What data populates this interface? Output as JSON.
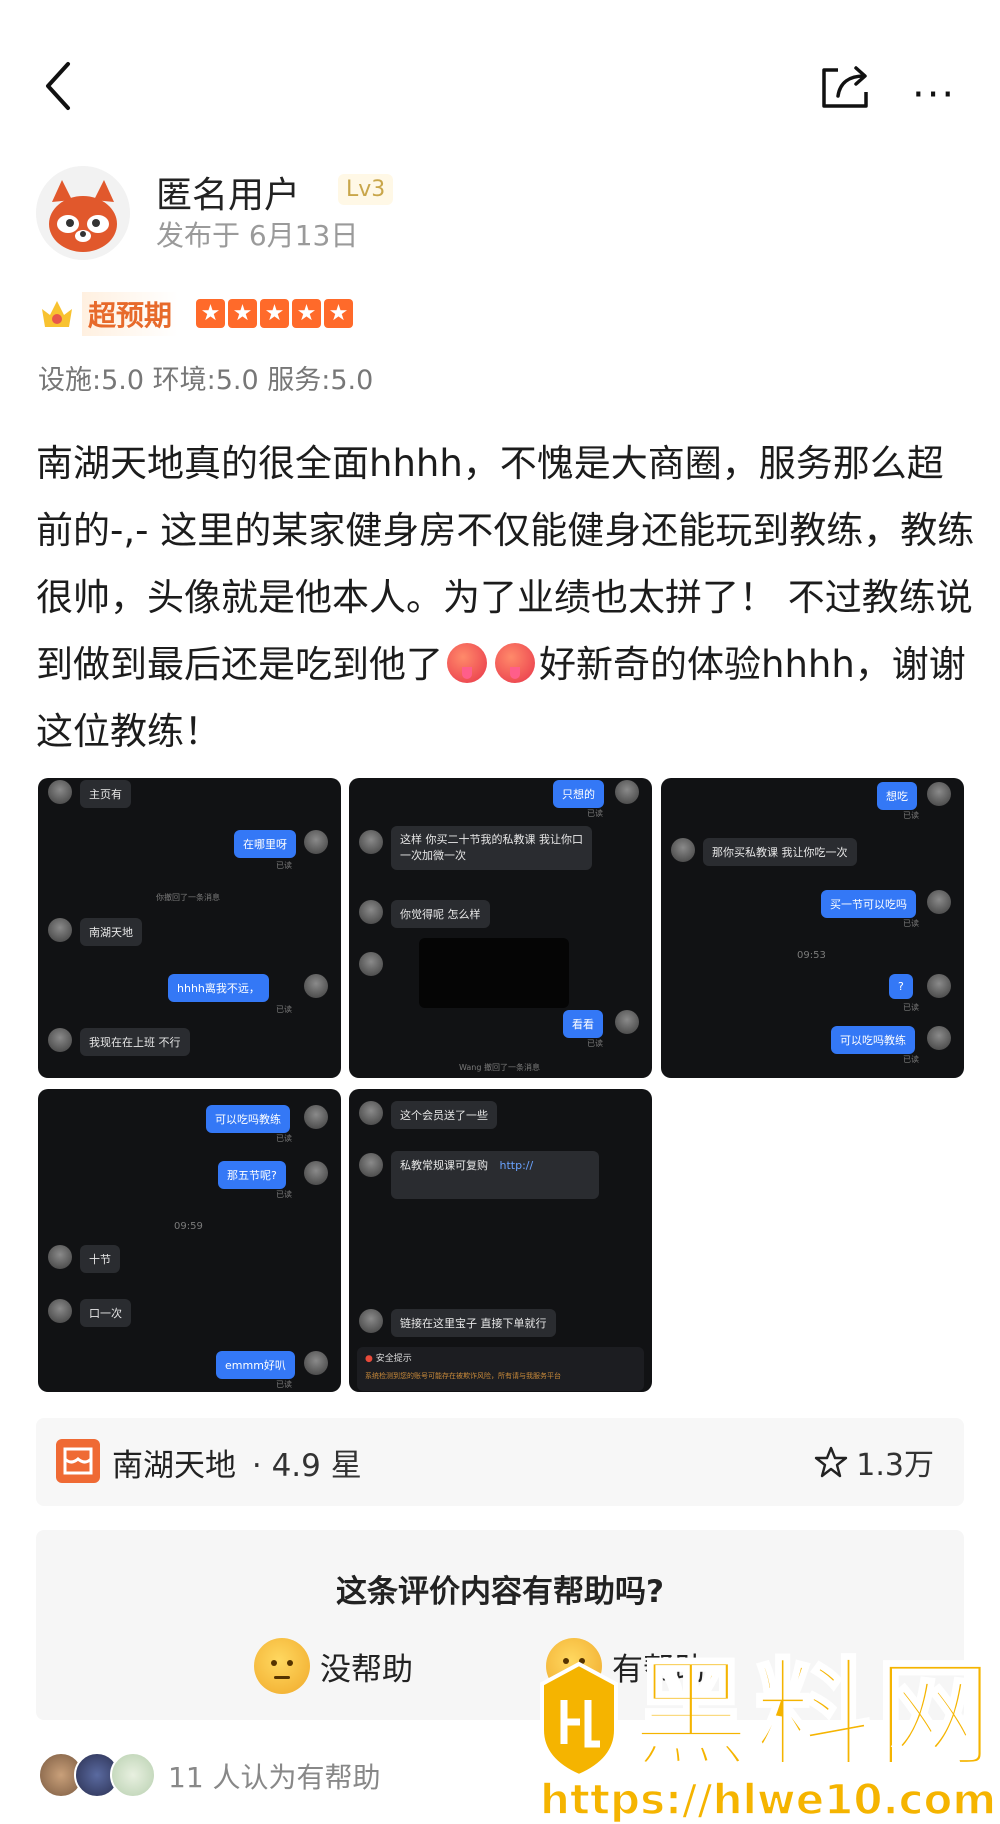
{
  "author": {
    "name": "匿名用户",
    "level": "Lv3",
    "published": "发布于 6月13日"
  },
  "rating": {
    "label": "超预期",
    "stars": 5,
    "max_stars": 5,
    "scores": "设施:5.0  环境:5.0  服务:5.0"
  },
  "review": {
    "text": "南湖天地真的很全面hhhh，不愧是大商圈，服务那么超前的-,-  这里的某家健身房不仅能健身还能玩到教练，教练很帅，头像就是他本人。为了业绩也太拼了！ 不过教练说到做到最后还是吃到他了",
    "tail": "好新奇的体验hhhh，谢谢这位教练！"
  },
  "screenshots": {
    "s1": {
      "m1": "主页有",
      "m2": "在哪里呀",
      "m3": "你撤回了一条消息",
      "m4": "南湖天地",
      "m5": "hhhh离我不远，",
      "m6": "我现在在上班 不行",
      "read": "已读"
    },
    "s2": {
      "m1": "只想的",
      "m2": "这样 你买二十节我的私教课 我让你口",
      "m2b": "一次加微一次",
      "m3": "你觉得呢 怎么样",
      "m4": "看看",
      "m5": "Wang 撤回了一条消息",
      "read": "已读"
    },
    "s3": {
      "m1": "想吃",
      "m2": "那你买私教课 我让你吃一次",
      "m3": "买一节可以吃吗",
      "m4": "09:53",
      "m5": "?",
      "m6": "可以吃吗教练",
      "read": "已读"
    },
    "s4": {
      "m1": "可以吃吗教练",
      "m2": "那五节呢?",
      "m3": "09:59",
      "m4": "十节",
      "m5": "口一次",
      "m6": "emmm好叭",
      "read": "已读"
    },
    "s5": {
      "m1": "这个会员送了一些",
      "m2": "私教常规课可复购",
      "m2link": "http://",
      "m3": "链接在这里宝子 直接下单就行",
      "m4": "安全提示",
      "m5": "系统检测到您的账号可能存在被欺诈风险，所有请与我服务平台"
    }
  },
  "place": {
    "name": "南湖天地",
    "rating": "· 4.9 星",
    "favorites": "1.3万"
  },
  "helpful": {
    "question": "这条评价内容有帮助吗?",
    "no": "没帮助",
    "yes": "有帮助"
  },
  "voters": {
    "text": "11 人认为有帮助"
  },
  "watermark": {
    "brand": "黑料网",
    "url": "https://hlwe10.com"
  },
  "colors": {
    "accent": "#ef6a34",
    "star": "#ff6a2a",
    "watermark": "#f5b400",
    "bubble_blue": "#3478f6"
  }
}
